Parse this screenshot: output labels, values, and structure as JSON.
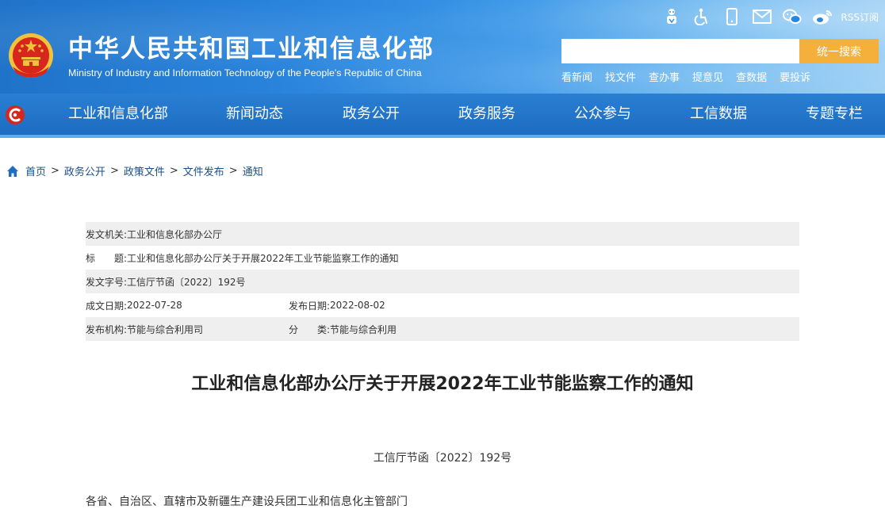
{
  "header": {
    "title": "中华人民共和国工业和信息化部",
    "subtitle": "Ministry of Industry and Information Technology of the People's Republic of China",
    "top_icons": [
      "elder-care-icon",
      "accessibility-icon",
      "mobile-icon",
      "email-icon",
      "wechat-icon",
      "weibo-icon"
    ],
    "rss_label": "RSS订阅",
    "search": {
      "placeholder": "",
      "button_label": "统一搜索"
    },
    "quick_links": [
      "看新闻",
      "找文件",
      "查办事",
      "提意见",
      "查数据",
      "要投诉"
    ]
  },
  "nav": {
    "items": [
      "工业和信息化部",
      "新闻动态",
      "政务公开",
      "政务服务",
      "公众参与",
      "工信数据",
      "专题专栏"
    ]
  },
  "breadcrumb": [
    "首页",
    "政务公开",
    "政策文件",
    "文件发布",
    "通知"
  ],
  "info": {
    "issuer_label": "发文机关:",
    "issuer": "工业和信息化部办公厅",
    "title_label": "标　　题:",
    "title": "工业和信息化部办公厅关于开展2022年工业节能监察工作的通知",
    "docno_label": "发文字号:",
    "docno": "工信厅节函〔2022〕192号",
    "created_label": "成文日期:",
    "created": "2022-07-28",
    "published_label": "发布日期:",
    "published": "2022-08-02",
    "org_label": "发布机构:",
    "org": "节能与综合利用司",
    "category_label": "分　　类:",
    "category": "节能与综合利用"
  },
  "document": {
    "title": "工业和信息化部办公厅关于开展2022年工业节能监察工作的通知",
    "number": "工信厅节函〔2022〕192号",
    "body_first_line": "各省、自治区、直辖市及新疆生产建设兵团工业和信息化主管部门"
  },
  "colors": {
    "header_blue": "#1f73c9",
    "nav_blue": "#1c6cc1",
    "search_button": "#f5b03c",
    "emblem_red": "#d7261e",
    "emblem_gold": "#f3c23a"
  }
}
